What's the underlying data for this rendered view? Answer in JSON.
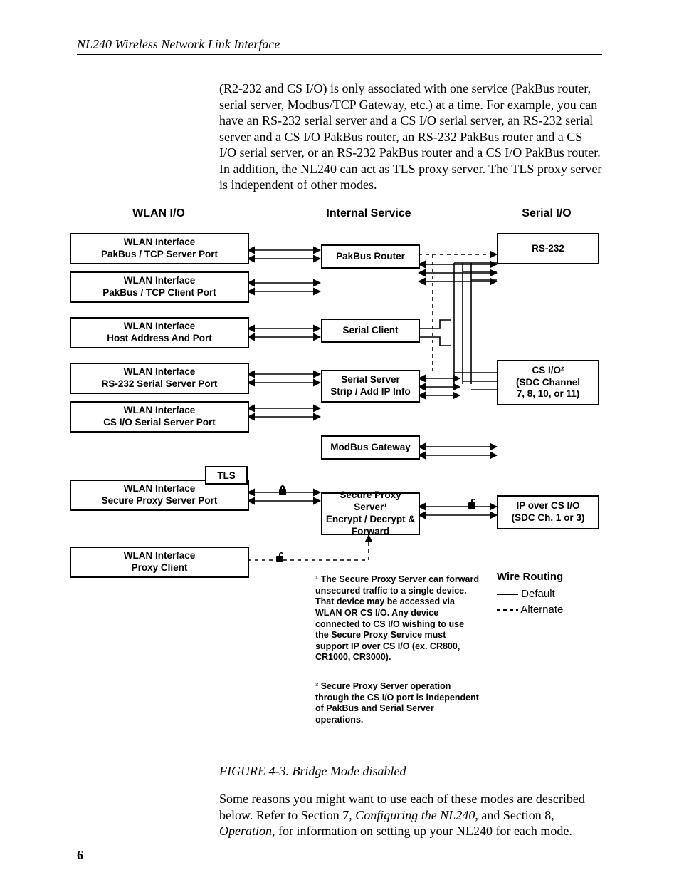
{
  "doc": {
    "runningHead": "NL240 Wireless Network Link Interface",
    "pageNumber": "6",
    "para1": "(R2-232 and CS I/O) is only associated with one service (PakBus router, serial server, Modbus/TCP Gateway, etc.) at a time.  For example, you can have an RS-232 serial server and a CS I/O serial server, an RS-232 serial server and a CS I/O PakBus router, an RS-232 PakBus router and a CS I/O serial server, or an RS-232 PakBus router and a CS I/O PakBus router.  In addition, the NL240 can act as TLS proxy server.  The TLS proxy server is independent of other modes.",
    "figCaption": "FIGURE 4-3.  Bridge Mode disabled",
    "para2a": "Some reasons you might want to use each of these modes are described below. Refer to Section 7, ",
    "para2b": "Configuring the NL240",
    "para2c": ", and Section 8, ",
    "para2d": "Operation",
    "para2e": ", for information on setting up your NL240 for each mode."
  },
  "diagram": {
    "cols": {
      "left": "WLAN I/O",
      "mid": "Internal Service",
      "right": "Serial I/O"
    },
    "left": {
      "b1": [
        "WLAN Interface",
        "PakBus / TCP Server Port"
      ],
      "b2": [
        "WLAN Interface",
        "PakBus / TCP Client Port"
      ],
      "b3": [
        "WLAN Interface",
        "Host Address And Port"
      ],
      "b4": [
        "WLAN Interface",
        "RS-232 Serial Server Port"
      ],
      "b5": [
        "WLAN Interface",
        "CS I/O Serial Server Port"
      ],
      "b6": [
        "WLAN Interface",
        "Secure Proxy Server Port"
      ],
      "b7": [
        "WLAN Interface",
        "Proxy Client"
      ]
    },
    "mid": {
      "m1": "PakBus Router",
      "m2": "Serial Client",
      "m3": [
        "Serial Server",
        "Strip / Add IP Info"
      ],
      "m4": "ModBus Gateway",
      "m5": [
        "Secure Proxy Server¹",
        "Encrypt / Decrypt &",
        "Forward"
      ]
    },
    "right": {
      "r1": "RS-232",
      "r2": [
        "CS I/O²",
        "(SDC Channel",
        "7, 8, 10, or 11)"
      ],
      "r3": [
        "IP over CS I/O",
        "(SDC Ch. 1 or 3)"
      ]
    },
    "tls": "TLS",
    "note1": "¹ The Secure Proxy Server can forward unsecured traffic to a single device. That device may be accessed via WLAN OR CS I/O. Any device connected to CS I/O wishing to use the Secure Proxy Service must support IP over CS I/O (ex. CR800, CR1000, CR3000).",
    "note2": "² Secure Proxy Server operation through the CS I/O port is independent of PakBus and Serial Server operations.",
    "legend": {
      "title": "Wire Routing",
      "a": "Default",
      "b": "Alternate"
    }
  }
}
